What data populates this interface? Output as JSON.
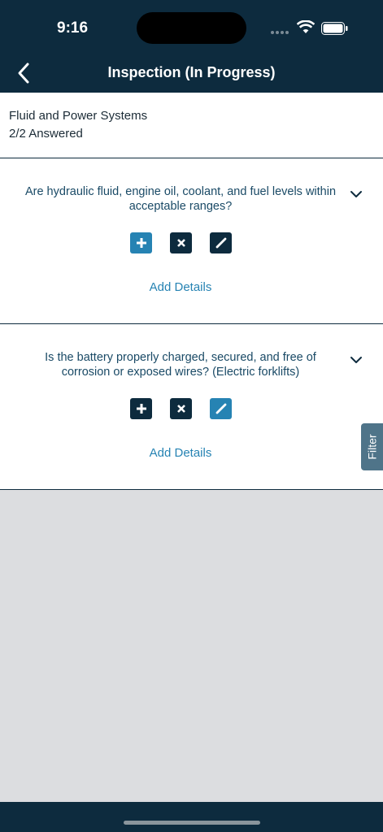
{
  "status_bar": {
    "time": "9:16"
  },
  "header": {
    "title": "Inspection (In Progress)"
  },
  "section": {
    "title": "Fluid and Power Systems",
    "answered": "2/2 Answered"
  },
  "questions": [
    {
      "text": "Are hydraulic fluid, engine oil, coolant, and fuel levels within acceptable ranges?",
      "add_details": "Add Details",
      "selected_action": "yes"
    },
    {
      "text": "Is the battery properly charged, secured, and free of corrosion or exposed wires? (Electric forklifts)",
      "add_details": "Add Details",
      "selected_action": "edit"
    }
  ],
  "filter": {
    "label": "Filter"
  },
  "colors": {
    "header": "#0d2b3e",
    "accent": "#2683b3",
    "filter_tab": "#4f7489"
  }
}
